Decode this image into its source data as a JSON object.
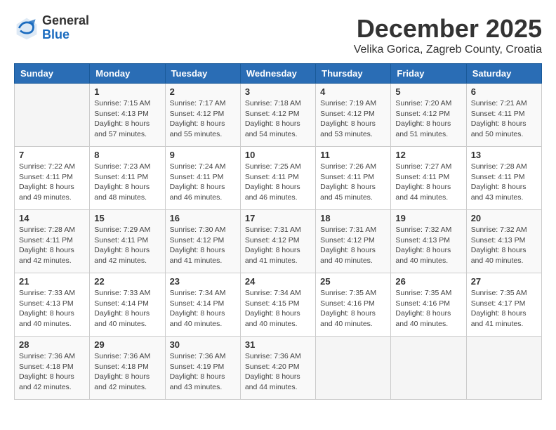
{
  "logo": {
    "general": "General",
    "blue": "Blue"
  },
  "title": "December 2025",
  "location": "Velika Gorica, Zagreb County, Croatia",
  "weekdays": [
    "Sunday",
    "Monday",
    "Tuesday",
    "Wednesday",
    "Thursday",
    "Friday",
    "Saturday"
  ],
  "weeks": [
    [
      {
        "day": "",
        "sunrise": "",
        "sunset": "",
        "daylight": ""
      },
      {
        "day": "1",
        "sunrise": "Sunrise: 7:15 AM",
        "sunset": "Sunset: 4:13 PM",
        "daylight": "Daylight: 8 hours and 57 minutes."
      },
      {
        "day": "2",
        "sunrise": "Sunrise: 7:17 AM",
        "sunset": "Sunset: 4:12 PM",
        "daylight": "Daylight: 8 hours and 55 minutes."
      },
      {
        "day": "3",
        "sunrise": "Sunrise: 7:18 AM",
        "sunset": "Sunset: 4:12 PM",
        "daylight": "Daylight: 8 hours and 54 minutes."
      },
      {
        "day": "4",
        "sunrise": "Sunrise: 7:19 AM",
        "sunset": "Sunset: 4:12 PM",
        "daylight": "Daylight: 8 hours and 53 minutes."
      },
      {
        "day": "5",
        "sunrise": "Sunrise: 7:20 AM",
        "sunset": "Sunset: 4:12 PM",
        "daylight": "Daylight: 8 hours and 51 minutes."
      },
      {
        "day": "6",
        "sunrise": "Sunrise: 7:21 AM",
        "sunset": "Sunset: 4:11 PM",
        "daylight": "Daylight: 8 hours and 50 minutes."
      }
    ],
    [
      {
        "day": "7",
        "sunrise": "Sunrise: 7:22 AM",
        "sunset": "Sunset: 4:11 PM",
        "daylight": "Daylight: 8 hours and 49 minutes."
      },
      {
        "day": "8",
        "sunrise": "Sunrise: 7:23 AM",
        "sunset": "Sunset: 4:11 PM",
        "daylight": "Daylight: 8 hours and 48 minutes."
      },
      {
        "day": "9",
        "sunrise": "Sunrise: 7:24 AM",
        "sunset": "Sunset: 4:11 PM",
        "daylight": "Daylight: 8 hours and 46 minutes."
      },
      {
        "day": "10",
        "sunrise": "Sunrise: 7:25 AM",
        "sunset": "Sunset: 4:11 PM",
        "daylight": "Daylight: 8 hours and 46 minutes."
      },
      {
        "day": "11",
        "sunrise": "Sunrise: 7:26 AM",
        "sunset": "Sunset: 4:11 PM",
        "daylight": "Daylight: 8 hours and 45 minutes."
      },
      {
        "day": "12",
        "sunrise": "Sunrise: 7:27 AM",
        "sunset": "Sunset: 4:11 PM",
        "daylight": "Daylight: 8 hours and 44 minutes."
      },
      {
        "day": "13",
        "sunrise": "Sunrise: 7:28 AM",
        "sunset": "Sunset: 4:11 PM",
        "daylight": "Daylight: 8 hours and 43 minutes."
      }
    ],
    [
      {
        "day": "14",
        "sunrise": "Sunrise: 7:28 AM",
        "sunset": "Sunset: 4:11 PM",
        "daylight": "Daylight: 8 hours and 42 minutes."
      },
      {
        "day": "15",
        "sunrise": "Sunrise: 7:29 AM",
        "sunset": "Sunset: 4:11 PM",
        "daylight": "Daylight: 8 hours and 42 minutes."
      },
      {
        "day": "16",
        "sunrise": "Sunrise: 7:30 AM",
        "sunset": "Sunset: 4:12 PM",
        "daylight": "Daylight: 8 hours and 41 minutes."
      },
      {
        "day": "17",
        "sunrise": "Sunrise: 7:31 AM",
        "sunset": "Sunset: 4:12 PM",
        "daylight": "Daylight: 8 hours and 41 minutes."
      },
      {
        "day": "18",
        "sunrise": "Sunrise: 7:31 AM",
        "sunset": "Sunset: 4:12 PM",
        "daylight": "Daylight: 8 hours and 40 minutes."
      },
      {
        "day": "19",
        "sunrise": "Sunrise: 7:32 AM",
        "sunset": "Sunset: 4:13 PM",
        "daylight": "Daylight: 8 hours and 40 minutes."
      },
      {
        "day": "20",
        "sunrise": "Sunrise: 7:32 AM",
        "sunset": "Sunset: 4:13 PM",
        "daylight": "Daylight: 8 hours and 40 minutes."
      }
    ],
    [
      {
        "day": "21",
        "sunrise": "Sunrise: 7:33 AM",
        "sunset": "Sunset: 4:13 PM",
        "daylight": "Daylight: 8 hours and 40 minutes."
      },
      {
        "day": "22",
        "sunrise": "Sunrise: 7:33 AM",
        "sunset": "Sunset: 4:14 PM",
        "daylight": "Daylight: 8 hours and 40 minutes."
      },
      {
        "day": "23",
        "sunrise": "Sunrise: 7:34 AM",
        "sunset": "Sunset: 4:14 PM",
        "daylight": "Daylight: 8 hours and 40 minutes."
      },
      {
        "day": "24",
        "sunrise": "Sunrise: 7:34 AM",
        "sunset": "Sunset: 4:15 PM",
        "daylight": "Daylight: 8 hours and 40 minutes."
      },
      {
        "day": "25",
        "sunrise": "Sunrise: 7:35 AM",
        "sunset": "Sunset: 4:16 PM",
        "daylight": "Daylight: 8 hours and 40 minutes."
      },
      {
        "day": "26",
        "sunrise": "Sunrise: 7:35 AM",
        "sunset": "Sunset: 4:16 PM",
        "daylight": "Daylight: 8 hours and 40 minutes."
      },
      {
        "day": "27",
        "sunrise": "Sunrise: 7:35 AM",
        "sunset": "Sunset: 4:17 PM",
        "daylight": "Daylight: 8 hours and 41 minutes."
      }
    ],
    [
      {
        "day": "28",
        "sunrise": "Sunrise: 7:36 AM",
        "sunset": "Sunset: 4:18 PM",
        "daylight": "Daylight: 8 hours and 42 minutes."
      },
      {
        "day": "29",
        "sunrise": "Sunrise: 7:36 AM",
        "sunset": "Sunset: 4:18 PM",
        "daylight": "Daylight: 8 hours and 42 minutes."
      },
      {
        "day": "30",
        "sunrise": "Sunrise: 7:36 AM",
        "sunset": "Sunset: 4:19 PM",
        "daylight": "Daylight: 8 hours and 43 minutes."
      },
      {
        "day": "31",
        "sunrise": "Sunrise: 7:36 AM",
        "sunset": "Sunset: 4:20 PM",
        "daylight": "Daylight: 8 hours and 44 minutes."
      },
      {
        "day": "",
        "sunrise": "",
        "sunset": "",
        "daylight": ""
      },
      {
        "day": "",
        "sunrise": "",
        "sunset": "",
        "daylight": ""
      },
      {
        "day": "",
        "sunrise": "",
        "sunset": "",
        "daylight": ""
      }
    ]
  ]
}
